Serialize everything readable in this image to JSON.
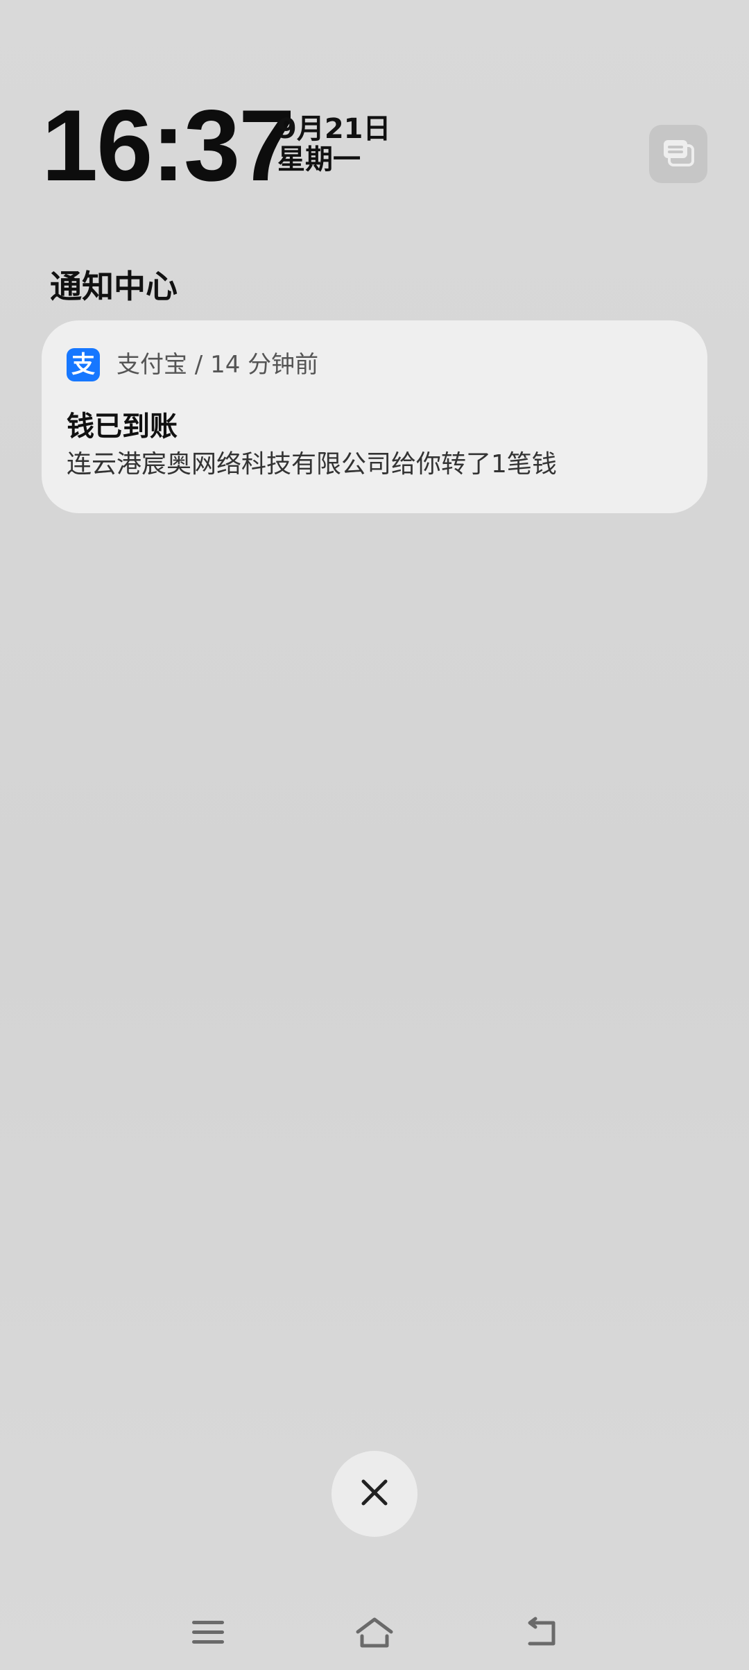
{
  "lockscreen": {
    "time": "16:37",
    "date": "9月21日",
    "weekday": "星期一"
  },
  "notification_center": {
    "title": "通知中心",
    "toggle_icon": "notification-stack-icon"
  },
  "notifications": [
    {
      "app_icon_glyph": "支",
      "app_meta": "支付宝 / 14 分钟前",
      "title": "钱已到账",
      "body": "连云港宸奥网络科技有限公司给你转了1笔钱",
      "icon_color": "#1677ff"
    }
  ],
  "actions": {
    "clear_icon": "close-icon"
  },
  "navbar": {
    "items": [
      "menu-icon",
      "home-icon",
      "back-icon"
    ]
  }
}
